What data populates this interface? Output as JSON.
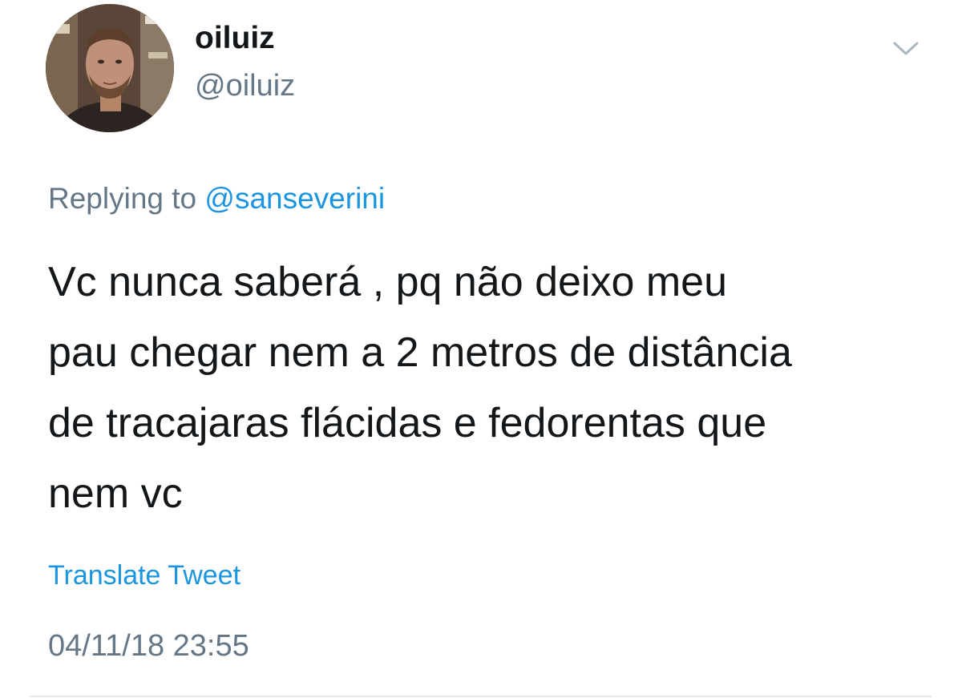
{
  "tweet": {
    "author": {
      "display_name": "oiluiz",
      "handle": "@oiluiz",
      "avatar_icon": "profile-photo"
    },
    "menu_icon": "chevron-down-icon",
    "reply_context": {
      "prefix": "Replying to ",
      "mention": "@sanseverini"
    },
    "text_lines": [
      "Vc nunca saberá , pq não deixo meu",
      "pau chegar nem a 2 metros de distância",
      "de tracajaras flácidas e fedorentas que",
      "nem vc"
    ],
    "translate_label": "Translate Tweet",
    "timestamp": "04/11/18 23:55"
  },
  "colors": {
    "text_primary": "#14171a",
    "text_secondary": "#657786",
    "link": "#1b95e0",
    "divider": "#e1e8ed"
  }
}
